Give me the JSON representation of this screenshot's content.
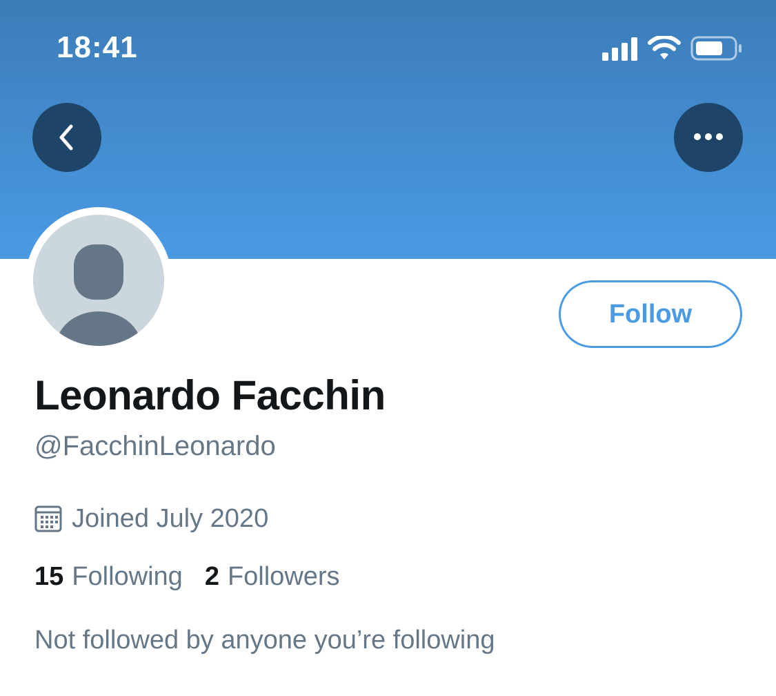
{
  "status_bar": {
    "time": "18:41",
    "icons": [
      "cellular-signal-icon",
      "wifi-icon",
      "battery-icon"
    ]
  },
  "header": {
    "back_icon": "chevron-left-icon",
    "more_icon": "more-horizontal-icon",
    "banner_color": "#4a9ae4"
  },
  "profile": {
    "display_name": "Leonardo Facchin",
    "handle": "@FacchinLeonardo",
    "avatar_icon": "default-avatar-icon",
    "joined": "Joined July 2020",
    "joined_icon": "calendar-icon",
    "following_count": "15",
    "following_label": "Following",
    "followers_count": "2",
    "followers_label": "Followers",
    "followed_by_note": "Not followed by anyone you’re following"
  },
  "actions": {
    "follow_label": "Follow",
    "accent_color": "#4a9ae4"
  }
}
